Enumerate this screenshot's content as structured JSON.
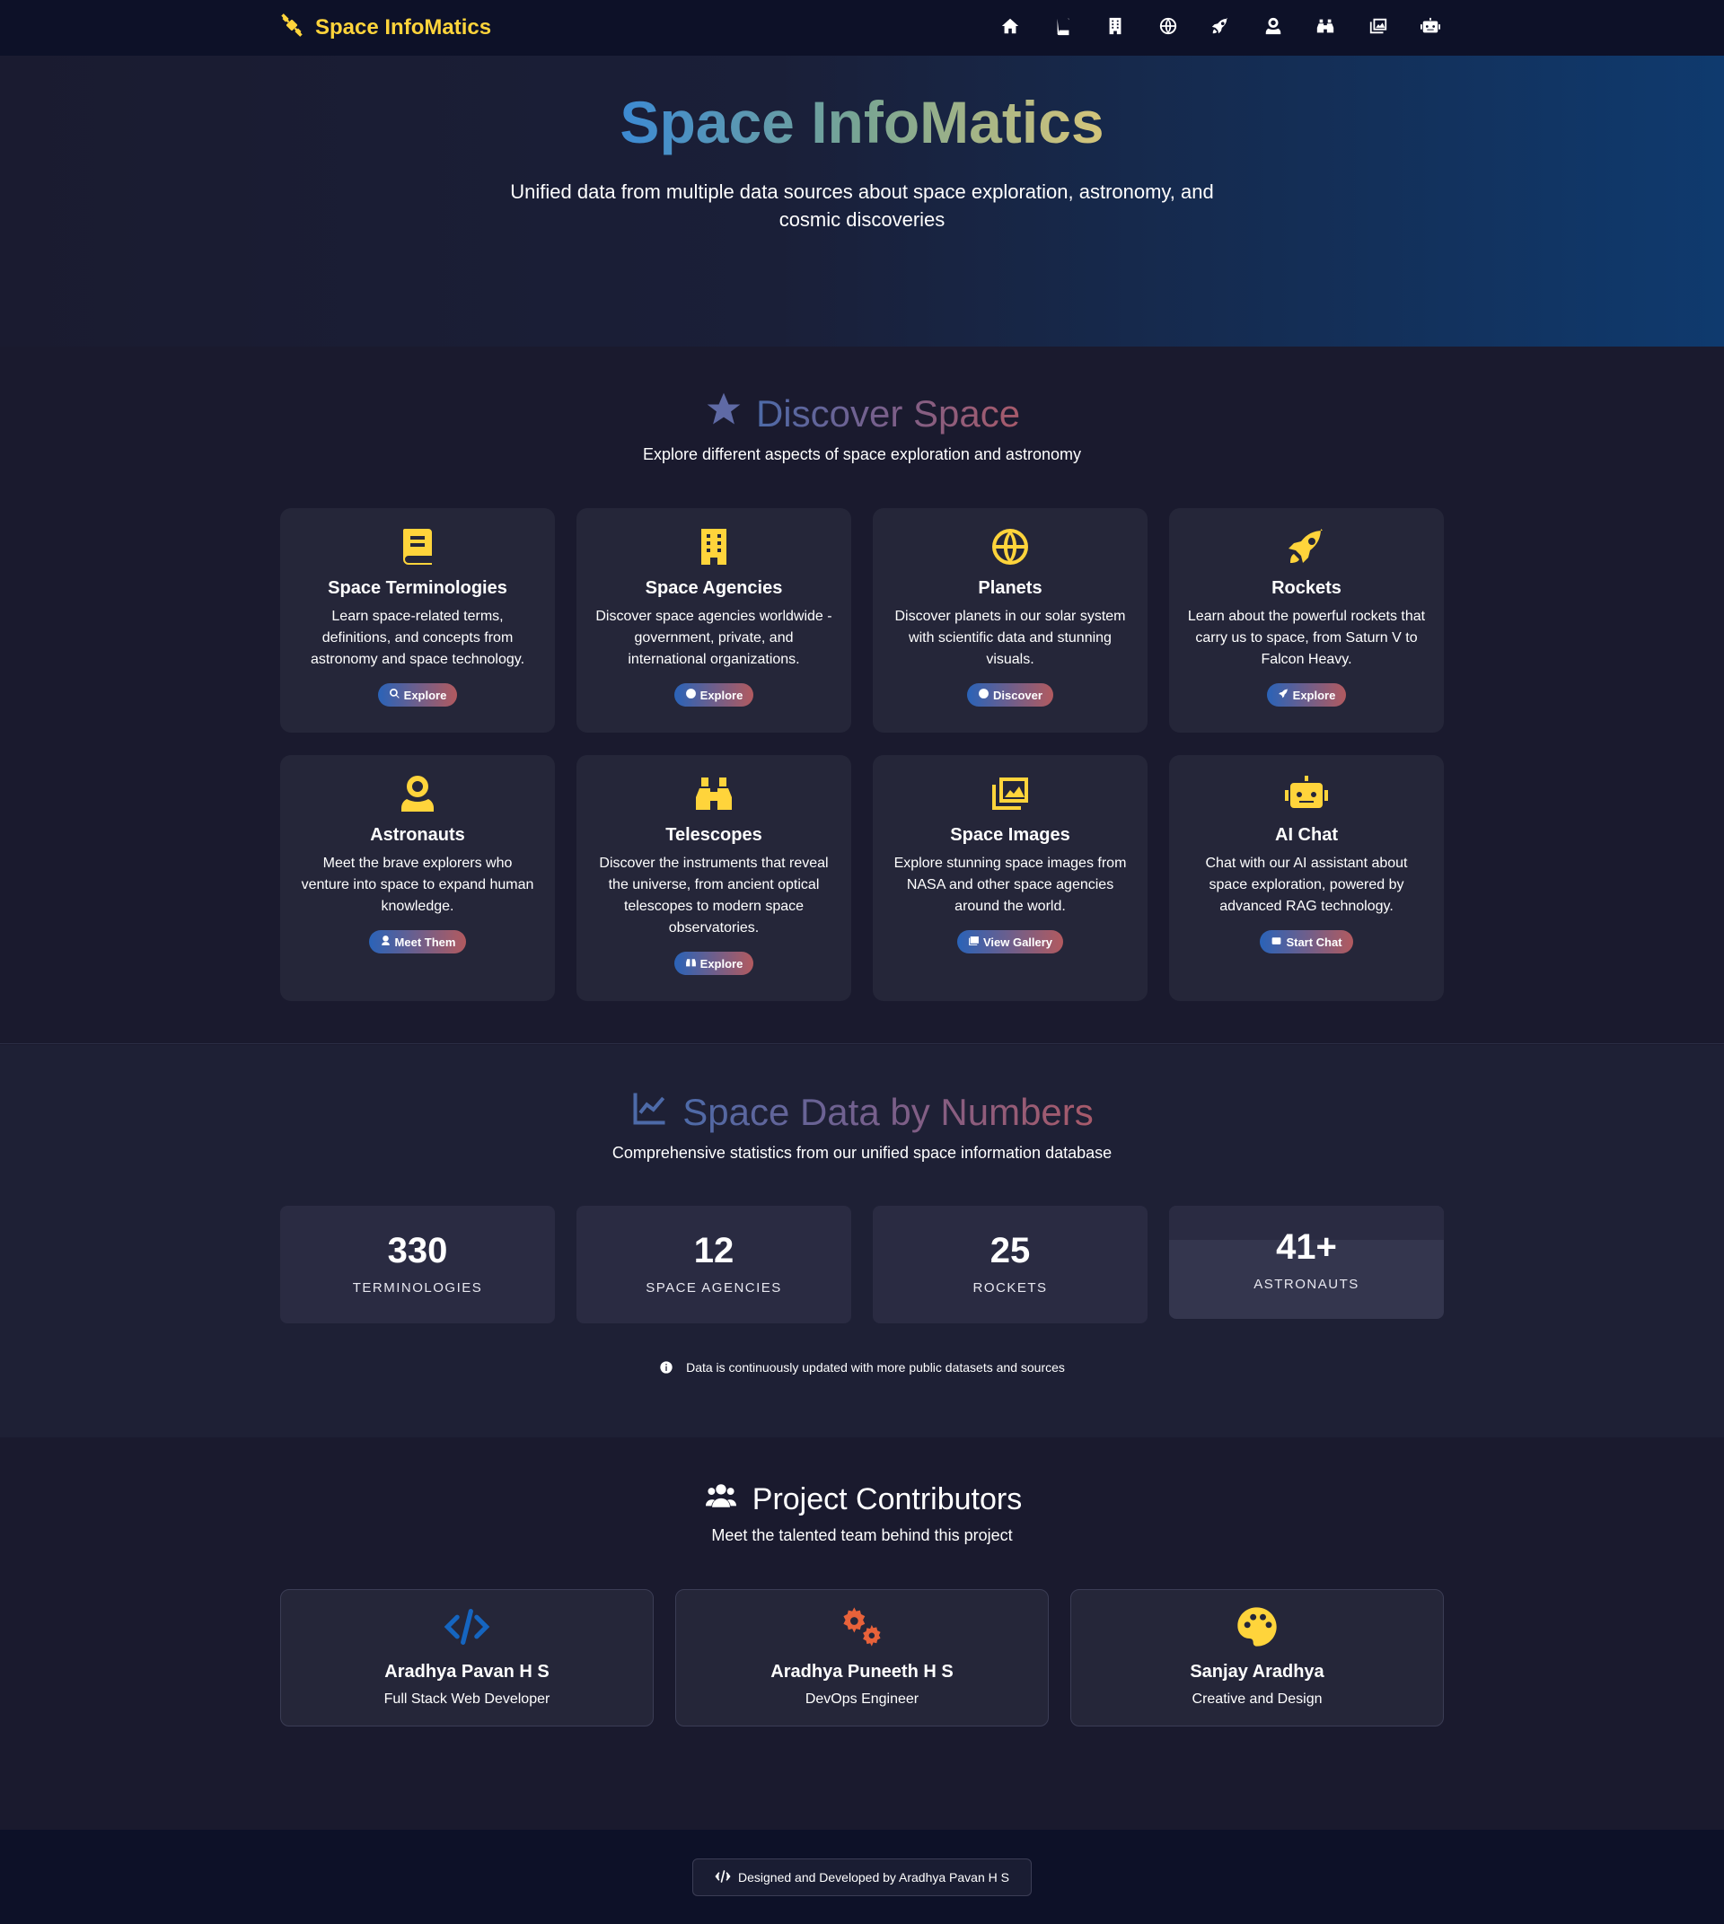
{
  "navbar": {
    "brand": "Space InfoMatics",
    "icons": [
      {
        "name": "home-icon"
      },
      {
        "name": "book-icon"
      },
      {
        "name": "building-icon"
      },
      {
        "name": "globe-icon"
      },
      {
        "name": "rocket-icon"
      },
      {
        "name": "astronaut-icon"
      },
      {
        "name": "binoculars-icon"
      },
      {
        "name": "images-icon"
      },
      {
        "name": "robot-icon"
      }
    ]
  },
  "hero": {
    "title": "Space InfoMatics",
    "subtitle": "Unified data from multiple data sources about space exploration, astronomy, and cosmic discoveries"
  },
  "discover": {
    "title": "Discover Space",
    "subtitle": "Explore different aspects of space exploration and astronomy",
    "cards": [
      {
        "title": "Space Terminologies",
        "desc": "Learn space-related terms, definitions, and concepts from astronomy and space technology.",
        "button": "Explore"
      },
      {
        "title": "Space Agencies",
        "desc": "Discover space agencies worldwide - government, private, and international organizations.",
        "button": "Explore"
      },
      {
        "title": "Planets",
        "desc": "Discover planets in our solar system with scientific data and stunning visuals.",
        "button": "Discover"
      },
      {
        "title": "Rockets",
        "desc": "Learn about the powerful rockets that carry us to space, from Saturn V to Falcon Heavy.",
        "button": "Explore"
      },
      {
        "title": "Astronauts",
        "desc": "Meet the brave explorers who venture into space to expand human knowledge.",
        "button": "Meet Them"
      },
      {
        "title": "Telescopes",
        "desc": "Discover the instruments that reveal the universe, from ancient optical telescopes to modern space observatories.",
        "button": "Explore"
      },
      {
        "title": "Space Images",
        "desc": "Explore stunning space images from NASA and other space agencies around the world.",
        "button": "View Gallery"
      },
      {
        "title": "AI Chat",
        "desc": "Chat with our AI assistant about space exploration, powered by advanced RAG technology.",
        "button": "Start Chat"
      }
    ]
  },
  "stats": {
    "title": "Space Data by Numbers",
    "subtitle": "Comprehensive statistics from our unified space information database",
    "items": [
      {
        "value": "330",
        "label": "TERMINOLOGIES"
      },
      {
        "value": "12",
        "label": "SPACE AGENCIES"
      },
      {
        "value": "25",
        "label": "ROCKETS"
      },
      {
        "value": "41+",
        "label": "ASTRONAUTS"
      }
    ],
    "note": "Data is continuously updated with more public datasets and sources"
  },
  "contributors": {
    "title": "Project Contributors",
    "subtitle": "Meet the talented team behind this project",
    "people": [
      {
        "name": "Aradhya Pavan H S",
        "role": "Full Stack Web Developer"
      },
      {
        "name": "Aradhya Puneeth H S",
        "role": "DevOps Engineer"
      },
      {
        "name": "Sanjay Aradhya",
        "role": "Creative and Design"
      }
    ]
  },
  "footer": {
    "credit": "Designed and Developed by Aradhya Pavan H S"
  },
  "colors": {
    "accent": "#ffd43b",
    "background": "#1a1a2e",
    "card": "#252639",
    "navbar": "#0d1128"
  }
}
